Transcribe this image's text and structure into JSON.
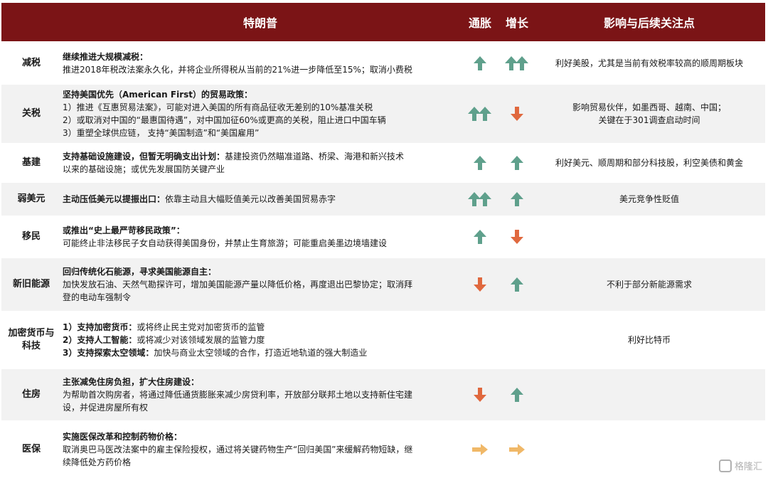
{
  "header": {
    "col_main": "特朗普",
    "col_inflation": "通胀",
    "col_growth": "增长",
    "col_impact": "影响与后续关注点"
  },
  "colors": {
    "header_bg": "#7b1416",
    "up": "#5fa08c",
    "down": "#e0683e",
    "neutral": "#f0b868"
  },
  "rows": [
    {
      "category": "减税",
      "title": "继续推进大规模减税：",
      "lines": [
        "推进2018年税改法案永久化，并将企业所得税从当前的21%进一步降低至15%；取消小费税"
      ],
      "inflation": "up",
      "growth": "double-up",
      "impact": [
        "利好美股，尤其是当前有效税率较高的顺周期板块"
      ]
    },
    {
      "category": "关税",
      "title": "坚持美国优先（American First）的贸易政策：",
      "lines": [
        "1）推进《互惠贸易法案》，可能对进入美国的所有商品征收无差别的10%基准关税",
        "2）或取消对中国的“最惠国待遇”，对中国加征60%或更高的关税，阻止进口中国车辆",
        "3）重塑全球供应链， 支持“美国制造”和“美国雇用”"
      ],
      "inflation": "double-up",
      "growth": "down",
      "impact": [
        "影响贸易伙伴，如墨西哥、越南、中国；",
        "关键在于301调查启动时间"
      ]
    },
    {
      "category": "基建",
      "title": "支持基础设施建设，但暂无明确支出计划：",
      "title_suffix": "基建投资仍然瞄准道路、桥梁、海港和新兴技术",
      "lines": [
        "以来的基础设施；或优先发展国防关键产业"
      ],
      "inflation": "up",
      "growth": "up",
      "impact": [
        "利好美元、顺周期和部分科技股，利空美债和黄金"
      ]
    },
    {
      "category": "弱美元",
      "title": "主动压低美元以提振出口：",
      "title_suffix": "依靠主动且大幅贬值美元以改善美国贸易赤字",
      "lines": [],
      "inflation": "double-up",
      "growth": "up",
      "impact": [
        "美元竞争性贬值"
      ]
    },
    {
      "category": "移民",
      "title": "或推出“史上最严苛移民政策”：",
      "lines": [
        "可能终止非法移民子女自动获得美国身份，并禁止生育旅游；可能重启美墨边境墙建设"
      ],
      "inflation": "up",
      "growth": "down",
      "impact": []
    },
    {
      "category": "新旧能源",
      "title": "回归传统化石能源，寻求美国能源自主：",
      "lines": [
        "加快发放石油、天然气勘探许可，增加美国能源产量以降低价格，再度退出巴黎协定；取消拜",
        "登的电动车强制令"
      ],
      "inflation": "down",
      "growth": "up",
      "impact": [
        "不利于部分新能源需求"
      ]
    },
    {
      "category": "加密货币与科技",
      "category_lines": [
        "加密货币与",
        "科技"
      ],
      "title": "",
      "items": [
        {
          "prefix": "1）支持加密货币：",
          "text": "或将终止民主党对加密货币的监管"
        },
        {
          "prefix": "2）支持人工智能：",
          "text": "或将减少对该领域发展的监管力度"
        },
        {
          "prefix": "3）支持探索太空领域：",
          "text": "加快与商业太空领域的合作，打造近地轨道的强大制造业"
        }
      ],
      "inflation": "",
      "growth": "",
      "impact": [
        "利好比特币"
      ]
    },
    {
      "category": "住房",
      "title": "主张减免住房负担，扩大住房建设：",
      "lines": [
        "为帮助首次购房者，将通过降低通货膨胀来减少房贷利率，开放部分联邦土地以支持新住宅建",
        "设，并促进房屋所有权"
      ],
      "inflation": "down",
      "growth": "up",
      "impact": []
    },
    {
      "category": "医保",
      "title": "实施医保改革和控制药物价格：",
      "lines": [
        "取消奥巴马医改法案中的雇主保险授权，通过将关键药物生产“回归美国”来缓解药物短缺，继",
        "续降低处方药价格"
      ],
      "inflation": "right",
      "growth": "right",
      "impact": []
    }
  ],
  "watermark": {
    "text": "格隆汇"
  }
}
